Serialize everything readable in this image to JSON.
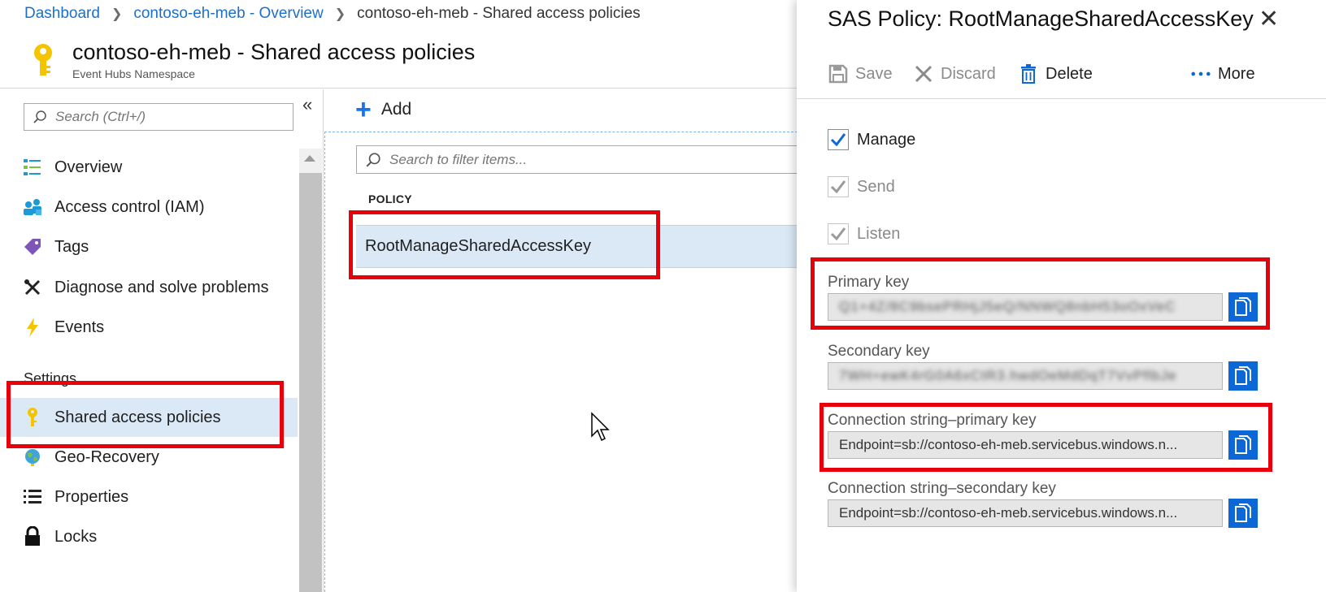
{
  "breadcrumb": {
    "items": [
      "Dashboard",
      "contoso-eh-meb - Overview"
    ],
    "current": "contoso-eh-meb - Shared access policies"
  },
  "header": {
    "title": "contoso-eh-meb - Shared access policies",
    "subtitle": "Event Hubs Namespace"
  },
  "sidebar": {
    "collapse_glyph": "«",
    "search_placeholder": "Search (Ctrl+/)",
    "items": [
      {
        "label": "Overview",
        "icon": "overview-icon"
      },
      {
        "label": "Access control (IAM)",
        "icon": "people-icon"
      },
      {
        "label": "Tags",
        "icon": "tag-icon"
      },
      {
        "label": "Diagnose and solve problems",
        "icon": "wrench-icon"
      },
      {
        "label": "Events",
        "icon": "lightning-icon"
      }
    ],
    "settings_label": "Settings",
    "settings_items": [
      {
        "label": "Shared access policies",
        "icon": "key-icon",
        "active": true
      },
      {
        "label": "Geo-Recovery",
        "icon": "globe-icon"
      },
      {
        "label": "Properties",
        "icon": "list-icon"
      },
      {
        "label": "Locks",
        "icon": "lock-icon"
      }
    ]
  },
  "policies": {
    "add_label": "Add",
    "filter_placeholder": "Search to filter items...",
    "column_header": "POLICY",
    "rows": [
      {
        "name": "RootManageSharedAccessKey",
        "selected": true
      }
    ]
  },
  "blade": {
    "title": "SAS Policy: RootManageSharedAccessKey",
    "toolbar": {
      "save": "Save",
      "discard": "Discard",
      "delete": "Delete",
      "more": "More"
    },
    "claims": [
      {
        "label": "Manage",
        "checked": true,
        "enabled": true
      },
      {
        "label": "Send",
        "checked": true,
        "enabled": false
      },
      {
        "label": "Listen",
        "checked": true,
        "enabled": false
      }
    ],
    "fields": [
      {
        "label": "Primary key",
        "value": "Q1+4Z/8C9bsePRHjJ5eQ/NNWQ8nbH53oOxVeC",
        "blurred": true
      },
      {
        "label": "Secondary key",
        "value": "7WH+ewK4rG0A6xCtR3.hwdOeMdDqT7VvPflbJe",
        "blurred": true
      },
      {
        "label": "Connection string–primary key",
        "value": "Endpoint=sb://contoso-eh-meb.servicebus.windows.n...",
        "blurred": false
      },
      {
        "label": "Connection string–secondary key",
        "value": "Endpoint=sb://contoso-eh-meb.servicebus.windows.n...",
        "blurred": false
      }
    ]
  },
  "colors": {
    "accent": "#0c68d6",
    "link": "#1e6fc7",
    "selection": "#dbe9f7",
    "highlight": "#e8000b"
  }
}
